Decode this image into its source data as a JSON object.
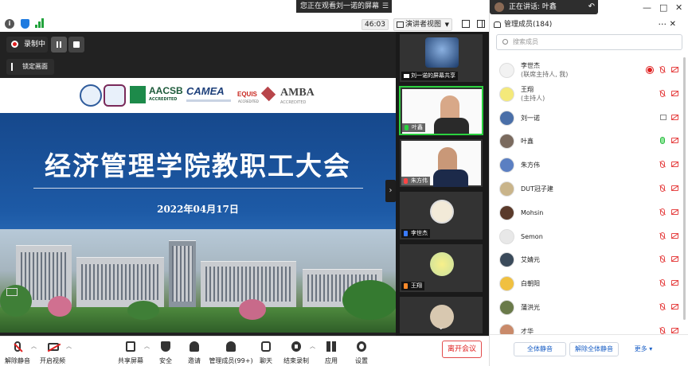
{
  "banner": {
    "text": "您正在观看刘一诺的屏幕"
  },
  "topbar": {
    "timer": "46:03",
    "view_label": "演讲者视图"
  },
  "recording": {
    "status": "录制中",
    "lock_label": "锁定画面"
  },
  "slide": {
    "title": "经济管理学院教职工大会",
    "date": "2022年04月17日",
    "logos": [
      "AACSB",
      "ACCREDITED",
      "CAMEA",
      "EQUIS",
      "ACCREDITED",
      "AMBA",
      "ACCREDITED"
    ]
  },
  "video_tiles": [
    {
      "name": "刘一诺的屏幕共享"
    },
    {
      "name": "叶鑫"
    },
    {
      "name": "朱方伟"
    },
    {
      "name": "李世杰"
    },
    {
      "name": "王翔"
    }
  ],
  "speaking": {
    "label": "正在讲话: 叶鑫"
  },
  "panel": {
    "title": "管理成员(184)",
    "search_placeholder": "搜索成员",
    "participants": [
      {
        "name": "李世杰",
        "role": "(联席主持人, 我)",
        "color": "#f2f2f2"
      },
      {
        "name": "王翔",
        "role": "(主持人)",
        "color": "#f4e97a"
      },
      {
        "name": "刘一诺",
        "role": "",
        "color": "#4a6fa8"
      },
      {
        "name": "叶鑫",
        "role": "",
        "color": "#7a6a5e"
      },
      {
        "name": "朱方伟",
        "role": "",
        "color": "#5b7fc2"
      },
      {
        "name": "DUT冠子建",
        "role": "",
        "color": "#c9b48a"
      },
      {
        "name": "Mohsin",
        "role": "",
        "color": "#5a3a2a"
      },
      {
        "name": "Semon",
        "role": "",
        "color": "#e8e8e8"
      },
      {
        "name": "艾婧元",
        "role": "",
        "color": "#3a4a5a"
      },
      {
        "name": "白朝阳",
        "role": "",
        "color": "#f0c040"
      },
      {
        "name": "蒲洪光",
        "role": "",
        "color": "#6a7a4a"
      },
      {
        "name": "才华",
        "role": "",
        "color": "#c98a6a"
      }
    ],
    "footer": {
      "mute_all": "全体静音",
      "unmute_all": "解除全体静音",
      "more": "更多"
    }
  },
  "toolbar": {
    "unmute": "解除静音",
    "start_video": "开启视频",
    "share_screen": "共享屏幕",
    "security": "安全",
    "invite": "邀请",
    "manage_members": "管理成员(99+)",
    "chat": "聊天",
    "end_recording": "结束录制",
    "apps": "应用",
    "settings": "设置",
    "leave": "离开会议"
  },
  "colors": {
    "accent": "#1a5fc6",
    "danger": "#e02020",
    "slide_blue": "#16488c"
  }
}
